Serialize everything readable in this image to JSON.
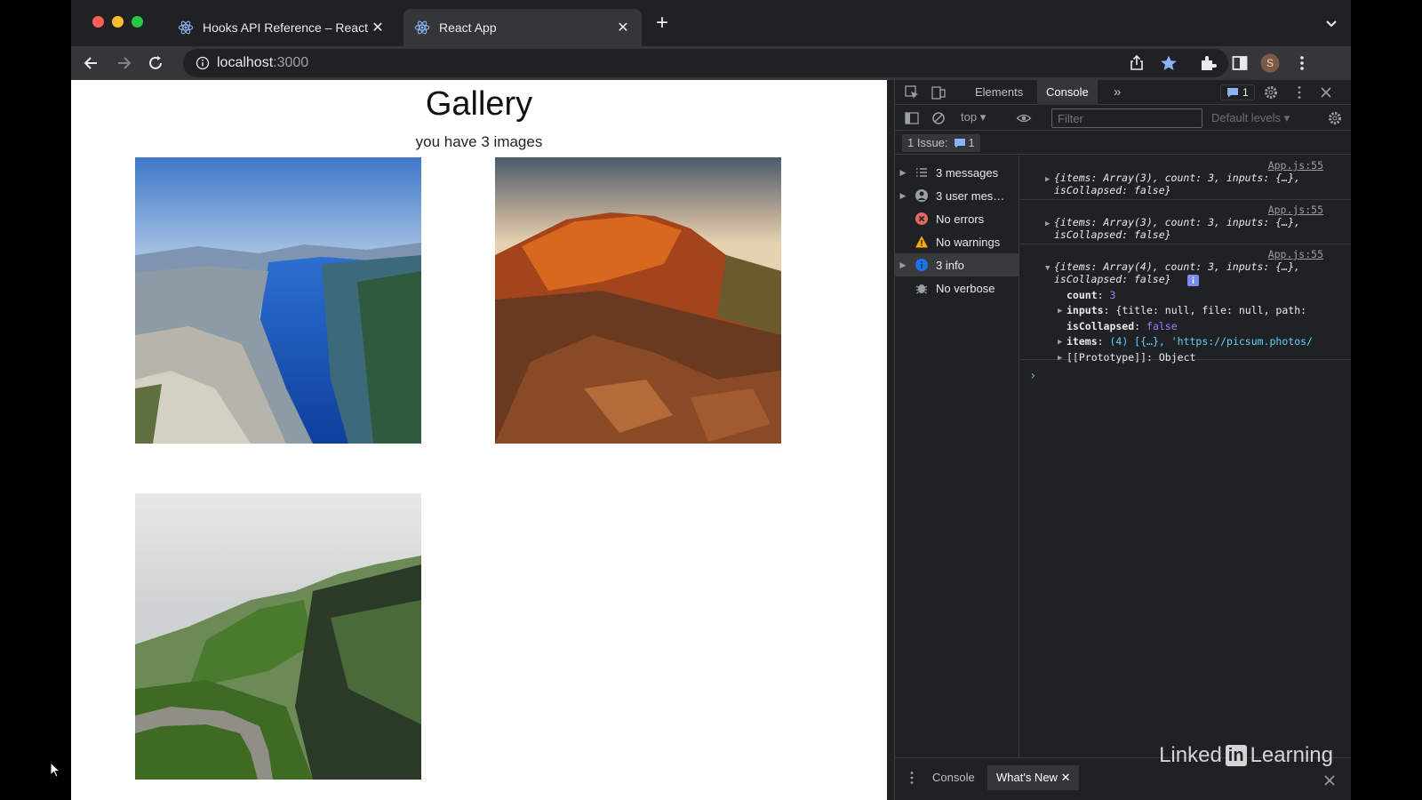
{
  "tabs": [
    {
      "title": "Hooks API Reference – React",
      "active": false
    },
    {
      "title": "React App",
      "active": true
    }
  ],
  "address": {
    "host": "localhost",
    "port": ":3000"
  },
  "page": {
    "title": "Gallery",
    "subtitle": "you have 3 images",
    "images": [
      "fjord-photo",
      "canyon-sunset-photo",
      "green-valley-road-photo"
    ]
  },
  "devtools": {
    "panels": [
      "Elements",
      "Console"
    ],
    "issues_badge": "1",
    "context": "top",
    "filter_placeholder": "Filter",
    "levels": "Default levels",
    "issues_chip": "1 Issue:",
    "issues_chip_count": "1",
    "sidebar": [
      {
        "label": "3 messages",
        "icon": "list-icon",
        "expandable": true
      },
      {
        "label": "3 user mes…",
        "icon": "user-icon",
        "expandable": true
      },
      {
        "label": "No errors",
        "icon": "error-icon",
        "expandable": false
      },
      {
        "label": "No warnings",
        "icon": "warning-icon",
        "expandable": false
      },
      {
        "label": "3 info",
        "icon": "info-icon",
        "expandable": true,
        "selected": true
      },
      {
        "label": "No verbose",
        "icon": "bug-icon",
        "expandable": false
      }
    ],
    "logs": [
      {
        "source": "App.js:55",
        "summary": "{items: Array(3), count: 3, inputs: {…},",
        "summary2": "isCollapsed: false}"
      },
      {
        "source": "App.js:55",
        "summary": "{items: Array(3), count: 3, inputs: {…},",
        "summary2": "isCollapsed: false}"
      },
      {
        "source": "App.js:55",
        "summary": "{items: Array(4), count: 3, inputs: {…},",
        "summary2": "isCollapsed: false}",
        "props": [
          {
            "key": "count",
            "value": "3"
          },
          {
            "key": "inputs",
            "value": "{title: null, file: null, path:"
          },
          {
            "key": "isCollapsed",
            "value": "false"
          },
          {
            "key": "items",
            "value": "(4) [{…}, 'https://picsum.photos/"
          },
          {
            "key": "[[Prototype]]",
            "value": "Object"
          }
        ]
      }
    ],
    "drawer_tabs": [
      "Console",
      "What's New"
    ]
  },
  "watermark": {
    "left": "Linked",
    "in": "in",
    "right": "Learning"
  },
  "colors": {
    "accent": "#8ab4f8",
    "error": "#f28b82",
    "warning": "#fdd663",
    "info": "#1a73e8"
  }
}
